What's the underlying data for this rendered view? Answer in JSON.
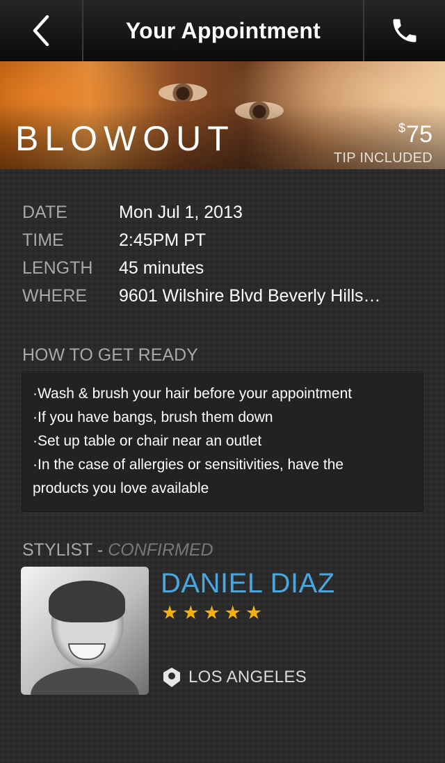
{
  "navbar": {
    "back_icon": "chevron-left-icon",
    "title": "Your Appointment",
    "call_icon": "phone-icon"
  },
  "hero": {
    "service": "BLOWOUT",
    "price_currency": "$",
    "price_amount": "75",
    "tip_note": "TIP INCLUDED"
  },
  "details": {
    "rows": [
      {
        "label": "DATE",
        "value": "Mon Jul 1, 2013"
      },
      {
        "label": "TIME",
        "value": "2:45PM PT"
      },
      {
        "label": "LENGTH",
        "value": "45 minutes"
      },
      {
        "label": "WHERE",
        "value": "9601 Wilshire Blvd Beverly Hills…"
      }
    ]
  },
  "get_ready": {
    "heading": "HOW TO GET READY",
    "lines": [
      "·Wash & brush your hair before your appointment",
      "·If you have bangs, brush them down",
      "·Set up table or chair near an outlet",
      "·In the case of allergies or sensitivities, have the",
      "products you love available"
    ]
  },
  "stylist": {
    "heading": "STYLIST - ",
    "status": "CONFIRMED",
    "name": "DANIEL DIAZ",
    "rating": 5,
    "rating_max": 5,
    "location_icon": "map-pin-icon",
    "location": "LOS ANGELES"
  },
  "colors": {
    "accent": "#4aa6dc",
    "star": "#f5b10a",
    "label": "#a8a8a8"
  }
}
